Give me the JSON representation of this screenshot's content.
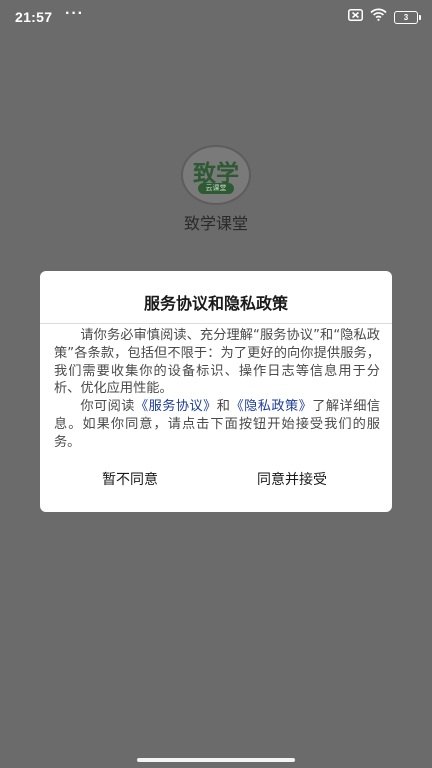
{
  "status_bar": {
    "time": "21:57",
    "dots": "···",
    "battery_level": "3"
  },
  "splash": {
    "logo_text": "致学",
    "logo_subtext": "云课堂",
    "app_name": "致学课堂"
  },
  "dialog": {
    "title": "服务协议和隐私政策",
    "para1": "请你务必审慎阅读、充分理解“服务协议”和“隐私政策”各条款，包括但不限于：为了更好的向你提供服务，我们需要收集你的设备标识、操作日志等信息用于分析、优化应用性能。",
    "para2_prefix": "你可阅读",
    "service_link": "《服务协议》",
    "para2_and": "和",
    "privacy_link": "《隐私政策》",
    "para2_suffix": "了解详细信息。如果你同意，请点击下面按钮开始接受我们的服务。",
    "disagree_label": "暂不同意",
    "agree_label": "同意并接受"
  },
  "colors": {
    "overlay": "#6b6b6b",
    "link": "#1d3e9a",
    "logo_green": "#2d5a33"
  }
}
